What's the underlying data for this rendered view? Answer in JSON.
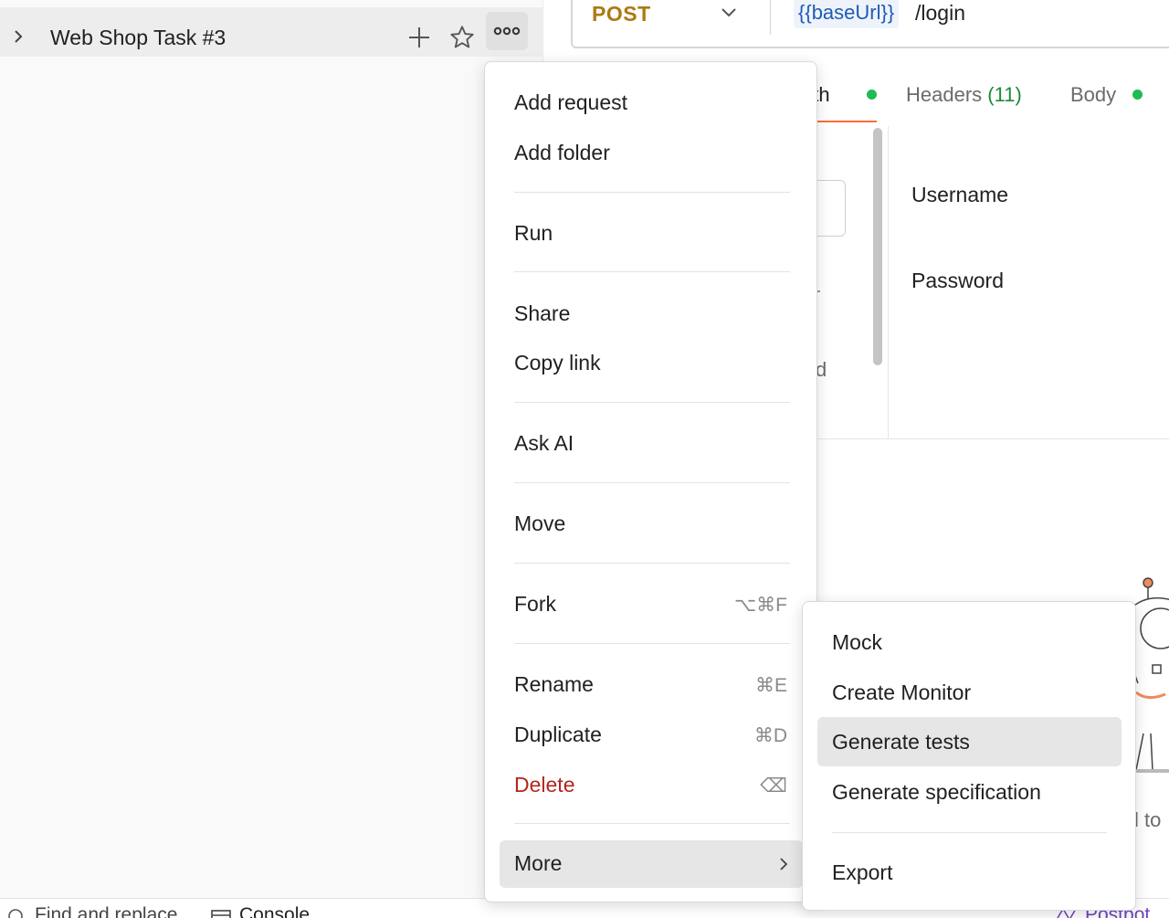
{
  "sidebar": {
    "collection_name": "Web Shop Task #3"
  },
  "request": {
    "method": "POST",
    "url_variable": "{{baseUrl}}",
    "url_path": "/login",
    "tabs": [
      {
        "label": "Auth",
        "visible_text": "uth"
      },
      {
        "label": "Headers",
        "count": "(11)"
      },
      {
        "label": "Body"
      }
    ],
    "fields": {
      "username_label": "Username",
      "password_label": "Password"
    },
    "partial_text_d": "d",
    "partial_text_to": "l to"
  },
  "context_menu": {
    "items": [
      {
        "label": "Add request"
      },
      {
        "label": "Add folder"
      },
      {
        "label": "Run"
      },
      {
        "label": "Share"
      },
      {
        "label": "Copy link"
      },
      {
        "label": "Ask AI"
      },
      {
        "label": "Move"
      },
      {
        "label": "Fork",
        "shortcut": "⌥⌘F"
      },
      {
        "label": "Rename",
        "shortcut": "⌘E"
      },
      {
        "label": "Duplicate",
        "shortcut": "⌘D"
      },
      {
        "label": "Delete",
        "shortcut": "⌫"
      },
      {
        "label": "More"
      }
    ]
  },
  "submenu": {
    "items": [
      {
        "label": "Mock"
      },
      {
        "label": "Create Monitor"
      },
      {
        "label": "Generate tests",
        "highlighted": true
      },
      {
        "label": "Generate specification"
      },
      {
        "label": "Export"
      }
    ]
  },
  "status_bar": {
    "find_replace": "Find and replace",
    "console": "Console",
    "postbot": "Postbot"
  },
  "colors": {
    "method_post": "#ab7a12",
    "url_variable": "#1f5bb5",
    "active_tab_underline": "#ff6c37",
    "status_dot": "#1fbb55",
    "delete": "#b3261e",
    "headers_count": "#1d8a3a"
  }
}
